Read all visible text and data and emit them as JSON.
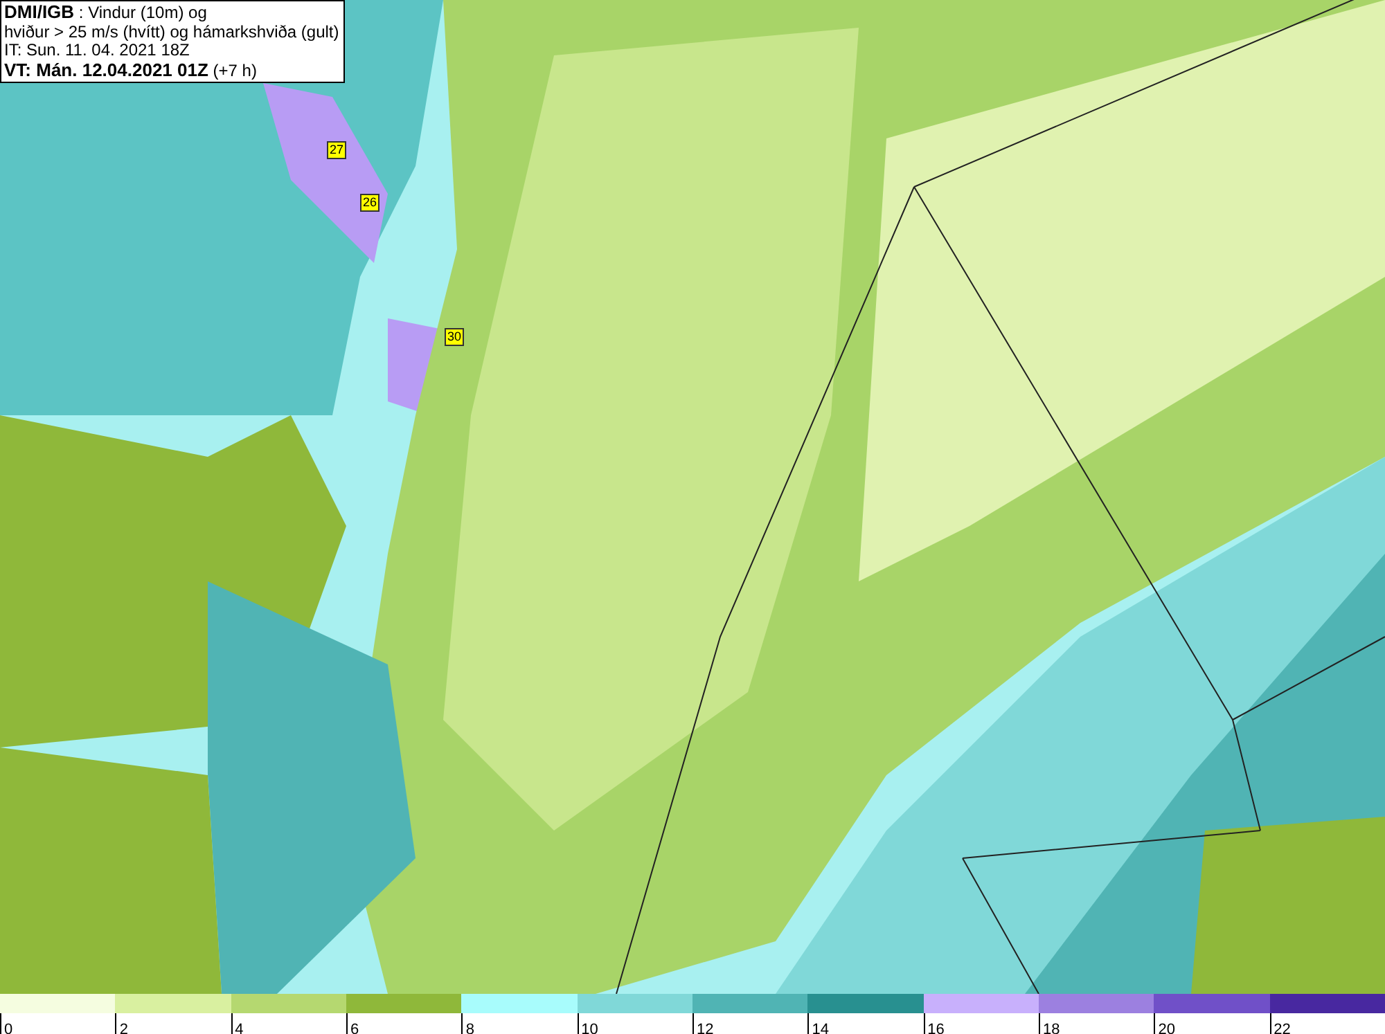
{
  "title_box": {
    "source": "DMI/IGB",
    "heading": " : Vindur (10m) og",
    "line_2": "hviður > 25 m/s (hvítt) og hámarkshviða (gult)",
    "issue_time": "IT: Sun. 11. 04. 2021 18Z",
    "valid_time": "VT: Mán. 12.04.2021 01Z",
    "lead": " (+7 h)"
  },
  "map": {
    "gust_labels": [
      "27",
      "26",
      "30"
    ]
  },
  "legend": {
    "bins": [
      {
        "color": "#f5fde0"
      },
      {
        "color": "#d9f0a0"
      },
      {
        "color": "#b5d870"
      },
      {
        "color": "#8fb83a"
      },
      {
        "color": "#a8fcfc"
      },
      {
        "color": "#80d8d8"
      },
      {
        "color": "#50b4b4"
      },
      {
        "color": "#289090"
      },
      {
        "color": "#c8b0fc"
      },
      {
        "color": "#9c80e0"
      },
      {
        "color": "#7050c8"
      },
      {
        "color": "#4828a0"
      }
    ],
    "ticks": [
      "0",
      "2",
      "4",
      "6",
      "8",
      "10",
      "12",
      "14",
      "16",
      "18",
      "20",
      "22"
    ]
  }
}
